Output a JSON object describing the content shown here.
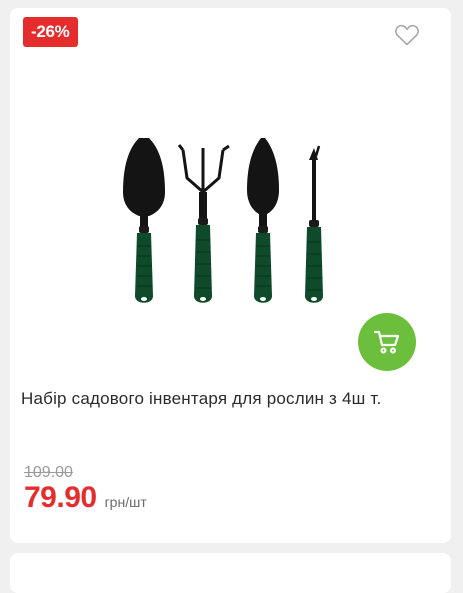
{
  "product": {
    "discount_badge": "-26%",
    "title": "Набір садового інвентаря для рослин з 4ш т.",
    "old_price": "109.00",
    "price": "79.90",
    "unit": "грн/шт"
  },
  "icons": {
    "wishlist": "heart-outline-icon",
    "cart": "shopping-cart-icon"
  },
  "colors": {
    "badge": "#e52d2d",
    "price": "#e52d2d",
    "cart_button": "#6cbf3c",
    "tool_handle": "#0f4a2a",
    "tool_metal": "#141414"
  }
}
